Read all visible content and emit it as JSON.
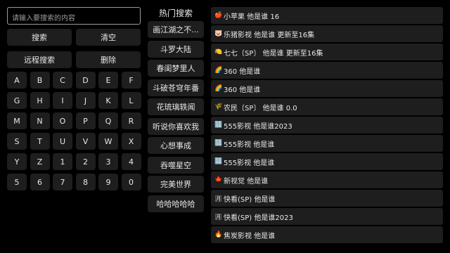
{
  "search": {
    "placeholder": "请输入要搜索的内容"
  },
  "buttons": {
    "search": "搜索",
    "clear": "清空",
    "remote_search": "远程搜索",
    "delete": "删除"
  },
  "keyboard": {
    "keys": [
      "A",
      "B",
      "C",
      "D",
      "E",
      "F",
      "G",
      "H",
      "I",
      "J",
      "K",
      "L",
      "M",
      "N",
      "O",
      "P",
      "Q",
      "R",
      "S",
      "T",
      "U",
      "V",
      "W",
      "X",
      "Y",
      "Z",
      "1",
      "2",
      "3",
      "4",
      "5",
      "6",
      "7",
      "8",
      "9",
      "0"
    ]
  },
  "hot": {
    "title": "热门搜索",
    "items": [
      "画江湖之不...",
      "斗罗大陆",
      "春闺梦里人",
      "斗破苍穹年番",
      "花琉璃轶闻",
      "听说你喜欢我",
      "心想事成",
      "吞噬星空",
      "完美世界",
      "哈哈哈哈哈"
    ]
  },
  "results": [
    {
      "icon": "🍎",
      "text": "小苹果  他是谁  16"
    },
    {
      "icon": "🐷",
      "text": "乐猪影视  他是谁  更新至16集"
    },
    {
      "icon": "🍋",
      "text": "七七〔SP〕 他是谁  更新至16集"
    },
    {
      "icon": "🌈",
      "text": "360  他是谁"
    },
    {
      "icon": "🌈",
      "text": "360  他是谁"
    },
    {
      "icon": "🌾",
      "text": "农民〔SP〕 他是谁  0.0"
    },
    {
      "icon": "🔢",
      "text": "555影视  他是谁2023"
    },
    {
      "icon": "🔢",
      "text": "555影视  他是谁"
    },
    {
      "icon": "🔢",
      "text": "555影视  他是谁"
    },
    {
      "icon": "🍁",
      "text": "新视觉  他是谁"
    },
    {
      "icon": "🈷",
      "text": "快看(SP)  他是谁"
    },
    {
      "icon": "🈷",
      "text": "快看(SP)  他是谁2023"
    },
    {
      "icon": "🔥",
      "text": "焦炭影视  他是谁"
    }
  ]
}
